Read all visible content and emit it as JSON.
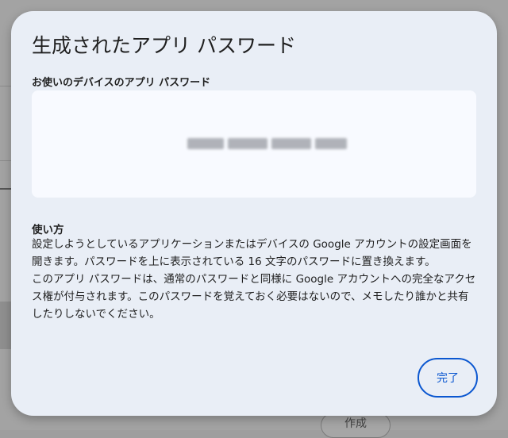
{
  "background": {
    "create_button_label": "作成"
  },
  "dialog": {
    "title": "生成されたアプリ パスワード",
    "password_section_label": "お使いのデバイスのアプリ パスワード",
    "password_masked": "xxxx xxxx xxxx xxxx",
    "howto_title": "使い方",
    "howto_paragraph_1": "設定しようとしているアプリケーションまたはデバイスの Google アカウントの設定画面を開きます。パスワードを上に表示されている 16 文字のパスワードに置き換えます。",
    "howto_paragraph_2": "このアプリ パスワードは、通常のパスワードと同様に Google アカウントへの完全なアクセス権が付与されます。このパスワードを覚えておく必要はないので、メモしたり誰かと共有したりしないでください。",
    "done_label": "完了"
  },
  "colors": {
    "dialog_bg": "#e9eef6",
    "password_box_bg": "#f8faff",
    "accent": "#0b57d0",
    "scrim": "#a3a3a3"
  }
}
